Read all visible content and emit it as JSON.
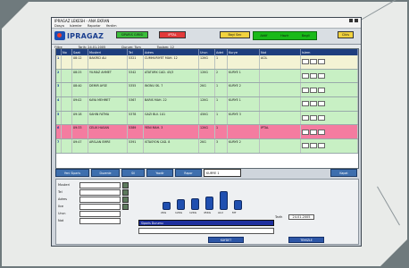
{
  "window": {
    "title": "IPRAGAZ LEKESH - ANA EKRAN",
    "menu": [
      "Dosya",
      "Islemler",
      "Raporlar",
      "Yardim"
    ]
  },
  "header": {
    "logo": "IPRAGAZ",
    "green_button": "SIPARIS GIRISI",
    "red_button": "IPTAL",
    "yellow_button": "Bayi Sec",
    "status": [
      "Aktif",
      "Hazir",
      "Bagli"
    ],
    "exit_button": "Cikis"
  },
  "subbar": [
    "Filtre",
    "Tarih: 24.01.2005",
    "Durum: Tum",
    "Toplam: 12"
  ],
  "table": {
    "columns": [
      "",
      "No",
      "Saat",
      "Musteri",
      "Tel",
      "Adres",
      "Urun",
      "Adet",
      "Kurye",
      "Not",
      "Islem"
    ],
    "rows": [
      {
        "style": "cream",
        "cells": [
          "1",
          "",
          "08:12",
          "BAKIRCI ALI",
          "5321",
          "CUMHURIYET MAH. 12",
          "12KG",
          "1",
          "",
          "ACIL",
          ""
        ]
      },
      {
        "style": "green",
        "cells": [
          "2",
          "",
          "08:25",
          "YILMAZ AHMET",
          "5342",
          "ATATURK CAD. 45/3",
          "12KG",
          "2",
          "KURYE 1",
          "",
          ""
        ]
      },
      {
        "style": "green",
        "cells": [
          "3",
          "",
          "08:40",
          "DEMIR AYSE",
          "5355",
          "INONU SK. 7",
          "2KG",
          "1",
          "KURYE 2",
          "",
          ""
        ]
      },
      {
        "style": "green",
        "cells": [
          "4",
          "",
          "09:02",
          "KAYA MEHMET",
          "5367",
          "BARIS MAH. 22",
          "12KG",
          "1",
          "KURYE 1",
          "",
          ""
        ]
      },
      {
        "style": "green",
        "cells": [
          "5",
          "",
          "09:18",
          "SAHIN FATMA",
          "5378",
          "GAZI BLV. 101",
          "45KG",
          "1",
          "KURYE 3",
          "",
          ""
        ]
      },
      {
        "style": "pink",
        "cells": [
          "6",
          "",
          "09:33",
          "CELIK HASAN",
          "5389",
          "YENI MAH. 3",
          "12KG",
          "1",
          "",
          "IPTAL",
          ""
        ]
      },
      {
        "style": "green",
        "cells": [
          "7",
          "",
          "09:47",
          "ARSLAN EMRE",
          "5391",
          "ISTASYON CAD. 8",
          "2KG",
          "3",
          "KURYE 2",
          "",
          ""
        ]
      }
    ]
  },
  "button_row": [
    "Yeni Siparis",
    "Duzenle",
    "Sil",
    "Yazdir",
    "Rapor",
    "Kapat"
  ],
  "dropdown_value": "KURYE 1",
  "form": {
    "labels": [
      "Musteri",
      "Tel",
      "Adres",
      "Ilce",
      "Urun",
      "Not"
    ],
    "values": [
      "",
      "",
      "",
      "",
      "",
      ""
    ]
  },
  "gauges": [
    {
      "label": "2KG",
      "level": 0.3
    },
    {
      "label": "12KG",
      "level": 0.42
    },
    {
      "label": "12KG",
      "level": 0.45
    },
    {
      "label": "45KG",
      "level": 0.55
    },
    {
      "label": "ALU",
      "level": 0.8
    },
    {
      "label": "MT",
      "level": 0.38
    }
  ],
  "bluebar_label": "Siparis Durumu",
  "rpanel": {
    "label": "Tarih",
    "value": "24.01.2005"
  },
  "action_buttons": [
    "KAYDET",
    "TEMIZLE"
  ],
  "colors": {
    "header": "#1e3e7e",
    "green_row": "#c8f0c4",
    "pink_row": "#f47ca0",
    "accent": "#2d56a6"
  }
}
